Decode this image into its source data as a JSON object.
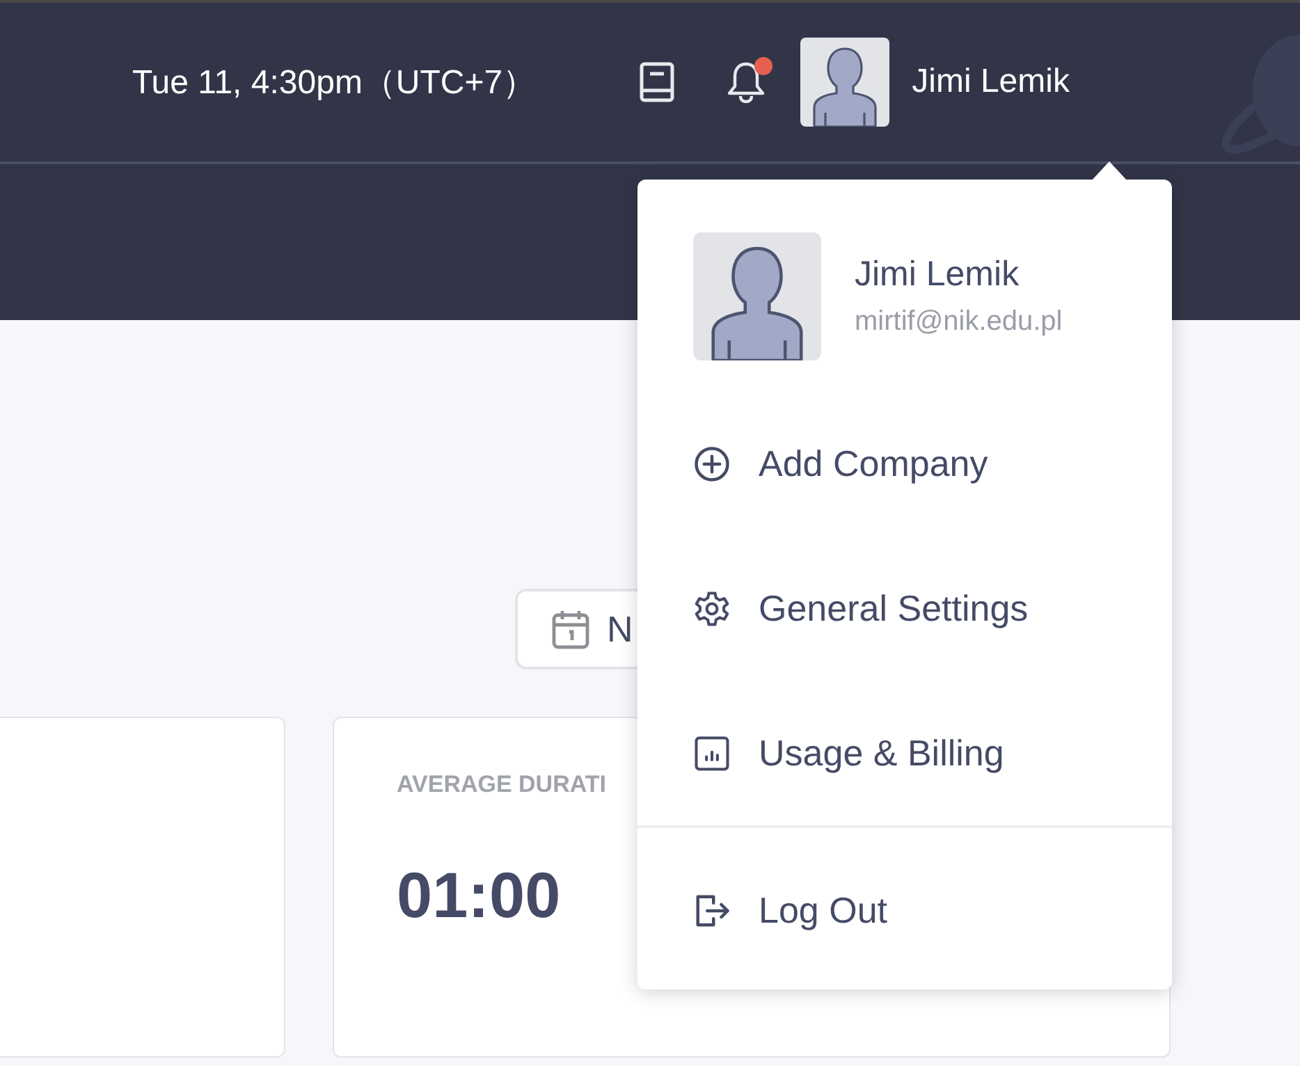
{
  "header": {
    "datetime": "Tue 11, 4:30pm（UTC+7）",
    "notifications_unread": true,
    "user_name": "Jimi Lemik"
  },
  "date_button": {
    "label": "N"
  },
  "stat_card": {
    "label": "AVERAGE DURATI",
    "value": "01:00"
  },
  "user_menu": {
    "name": "Jimi Lemik",
    "email": "mirtif@nik.edu.pl",
    "items": [
      {
        "kind": "add",
        "label": "Add Company"
      },
      {
        "kind": "settings",
        "label": "General Settings"
      },
      {
        "kind": "billing",
        "label": "Usage & Billing"
      },
      {
        "kind": "logout",
        "label": "Log Out"
      }
    ]
  }
}
